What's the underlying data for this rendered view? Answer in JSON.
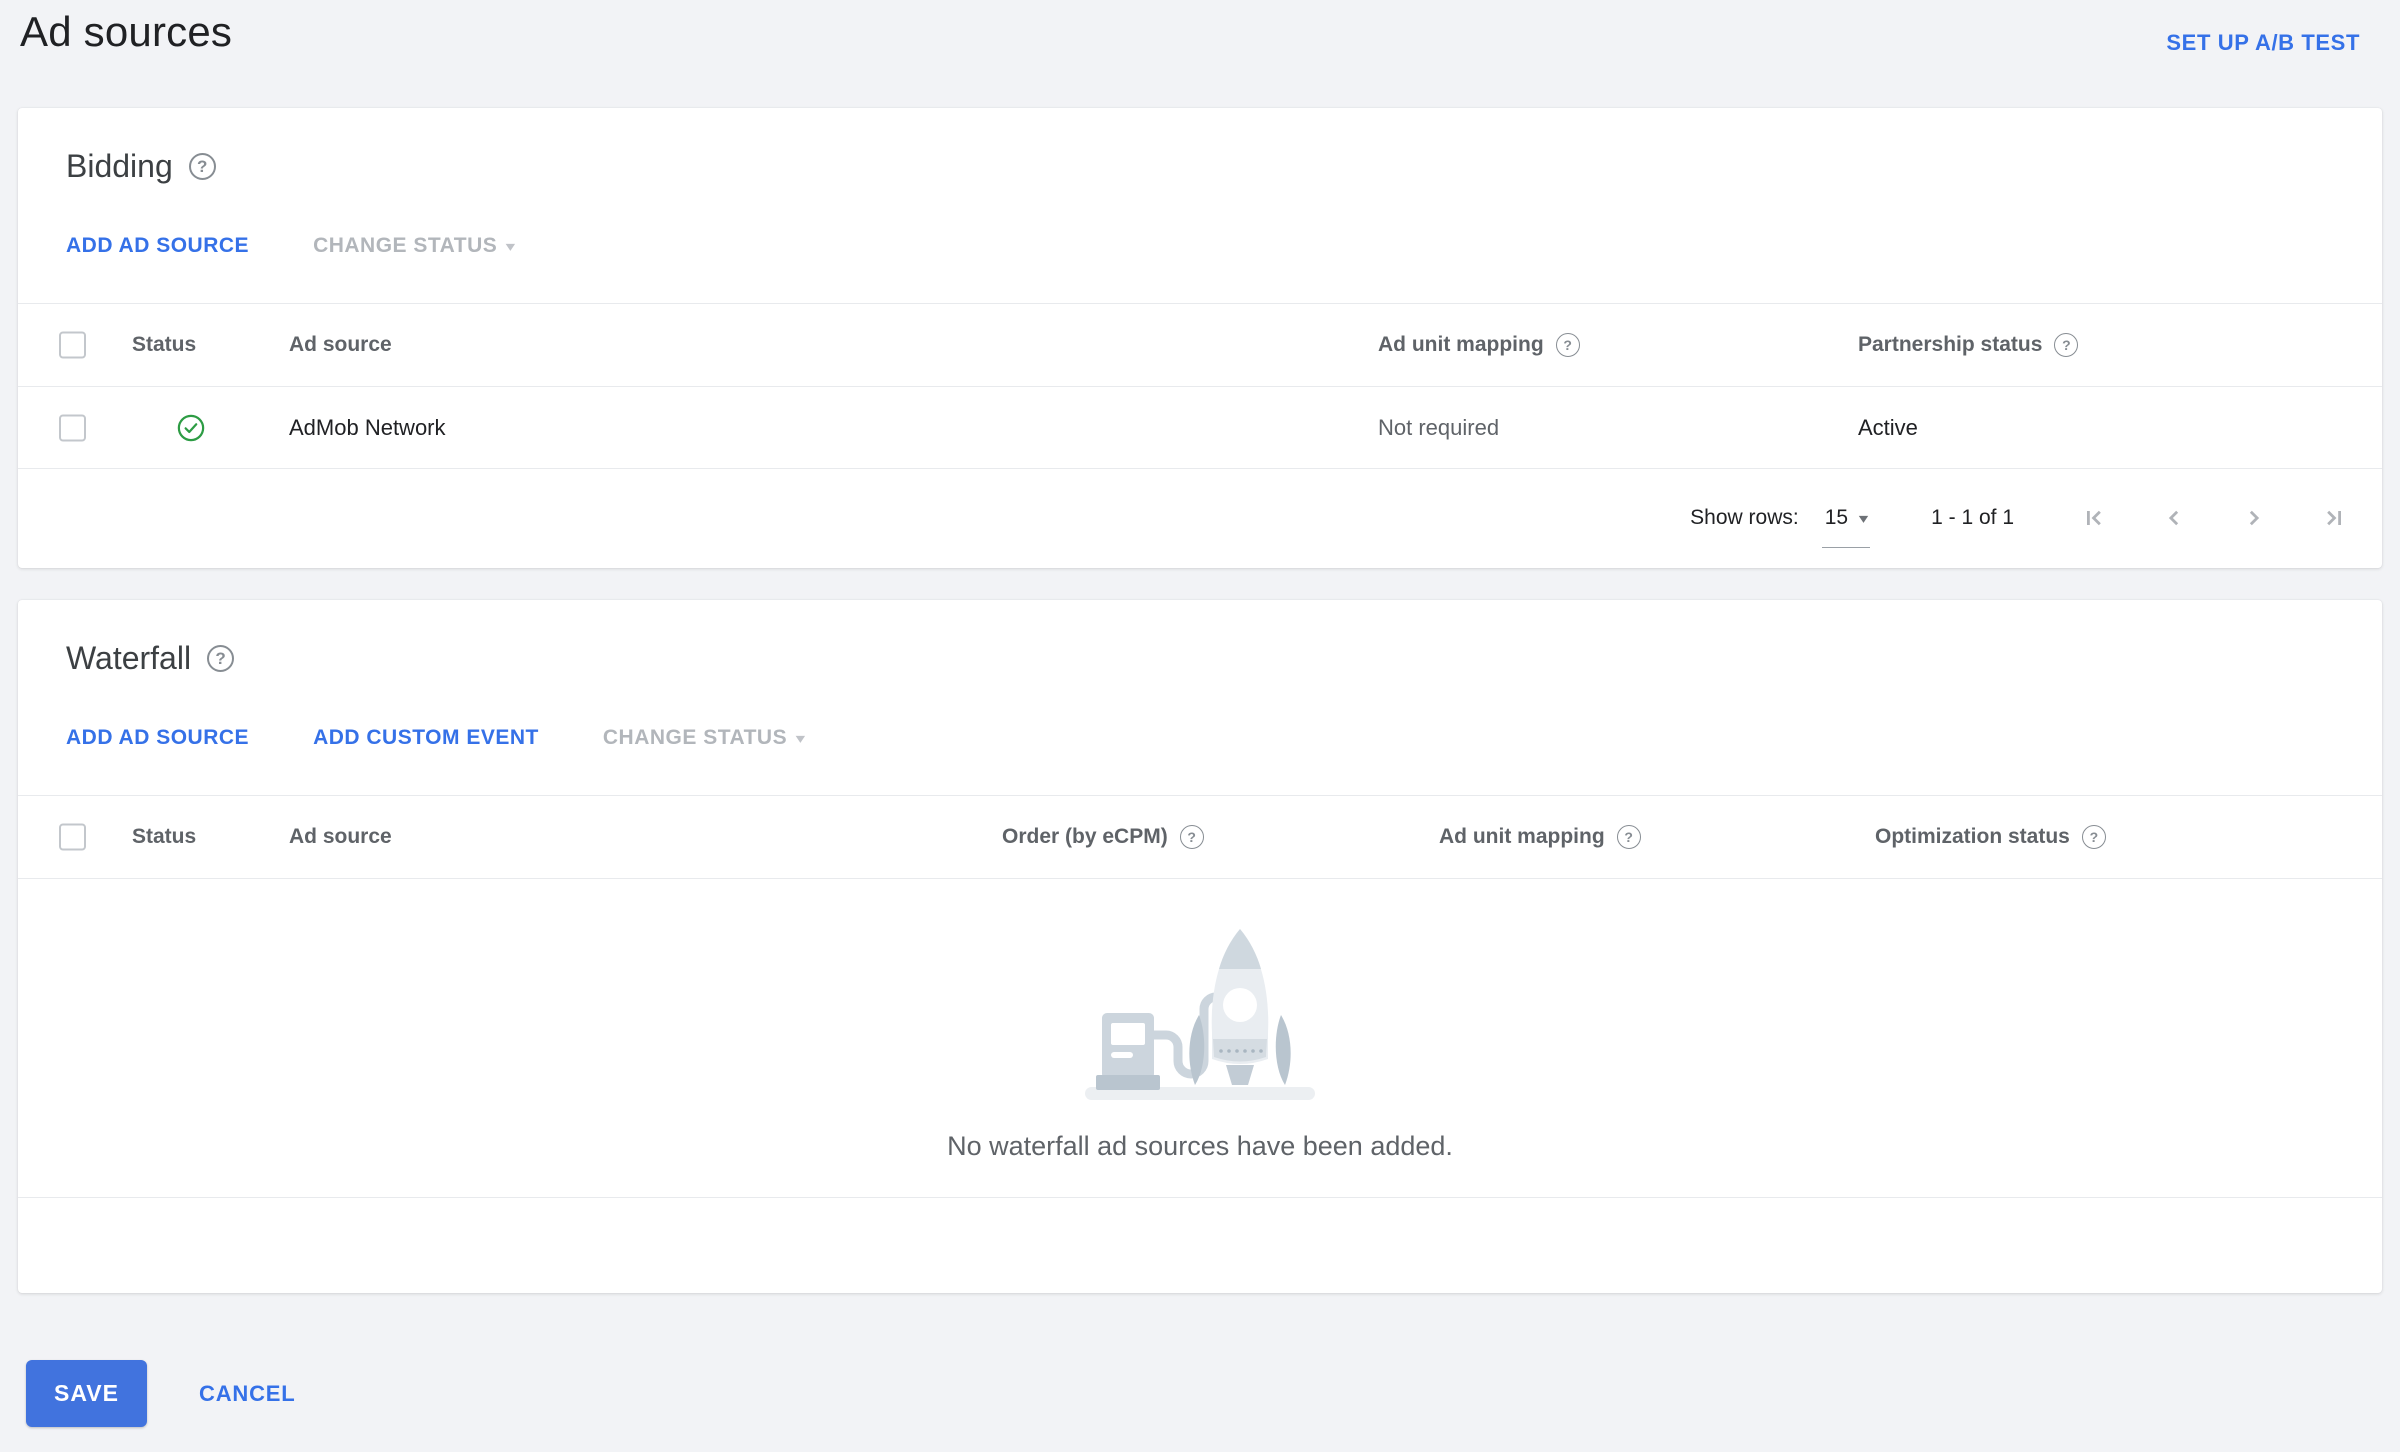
{
  "page": {
    "title": "Ad sources",
    "ab_test_link": "SET UP A/B TEST"
  },
  "colors": {
    "link_blue": "#3571e8",
    "save_button_blue": "#4173de",
    "success_green": "#2d9c44",
    "page_background": "#f2f3f6",
    "card_background": "#ffffff",
    "divider": "#e8eaed",
    "header_text_gray": "#5f6368",
    "disabled_text_gray": "#b2b6bb"
  },
  "icons": {
    "help": "?",
    "caret_down": "▾",
    "status_enabled": "check-circle-green",
    "pager": [
      "first-page",
      "previous-page",
      "next-page",
      "last-page"
    ],
    "empty_illustration": "rocket-and-fuel-pump"
  },
  "bidding": {
    "title": "Bidding",
    "actions": {
      "add_ad_source": "ADD AD SOURCE",
      "change_status": "CHANGE STATUS"
    },
    "columns": {
      "status": "Status",
      "ad_source": "Ad source",
      "ad_unit_mapping": "Ad unit mapping",
      "partnership_status": "Partnership status"
    },
    "rows": [
      {
        "status": "enabled",
        "ad_source": "AdMob Network",
        "ad_unit_mapping": "Not required",
        "partnership_status": "Active"
      }
    ],
    "pagination": {
      "show_rows_label": "Show rows:",
      "rows_per_page": "15",
      "range_label": "1 - 1 of 1"
    }
  },
  "waterfall": {
    "title": "Waterfall",
    "actions": {
      "add_ad_source": "ADD AD SOURCE",
      "add_custom_event": "ADD CUSTOM EVENT",
      "change_status": "CHANGE STATUS"
    },
    "columns": {
      "status": "Status",
      "ad_source": "Ad source",
      "order": "Order (by eCPM)",
      "ad_unit_mapping": "Ad unit mapping",
      "optimization_status": "Optimization status"
    },
    "empty_message": "No waterfall ad sources have been added."
  },
  "footer": {
    "save": "SAVE",
    "cancel": "CANCEL"
  }
}
